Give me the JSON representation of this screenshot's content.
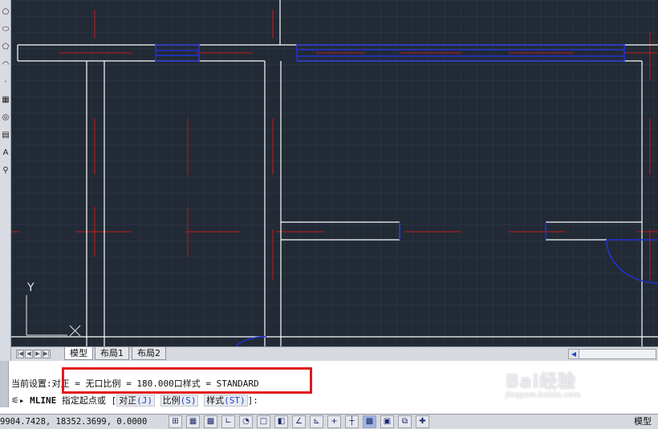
{
  "colors": {
    "canvas_bg": "#222a35",
    "wall_line": "#ffffff",
    "axis_line": "#c41a1a",
    "window_line": "#2331d6",
    "highlight_box": "#e0191e"
  },
  "left_toolbar": {
    "tools": [
      "circle-icon",
      "ellipse-icon",
      "polygon-icon",
      "arc-icon",
      "dot-icon",
      "hatch-icon",
      "region-icon",
      "table-icon",
      "text-icon",
      "insert-icon"
    ],
    "text_tool_glyph": "A"
  },
  "canvas": {
    "ucs_y_label": "Y",
    "ucs_x_label": "X"
  },
  "layout_tabs": {
    "tabs": [
      {
        "label": "模型",
        "active": true
      },
      {
        "label": "布局1",
        "active": false
      },
      {
        "label": "布局2",
        "active": false
      }
    ]
  },
  "command": {
    "settings_prefix": "当前设置:",
    "settings_text": "对正 = 无口比例 = 180.000口样式 = STANDARD",
    "prompt_command": "MLINE",
    "prompt_text": "指定起点或",
    "options": [
      {
        "label": "对正",
        "key": "(J)"
      },
      {
        "label": "比例",
        "key": "(S)"
      },
      {
        "label": "样式",
        "key": "(ST)"
      }
    ],
    "prompt_suffix": "]:",
    "prompt_bracket": "["
  },
  "status_bar": {
    "coordinates": "9904.7428,  18352.3699, 0.0000",
    "mode_label": "模型"
  },
  "watermark": {
    "brand": "Bai经验",
    "url": "jingyan.baidu.com"
  }
}
